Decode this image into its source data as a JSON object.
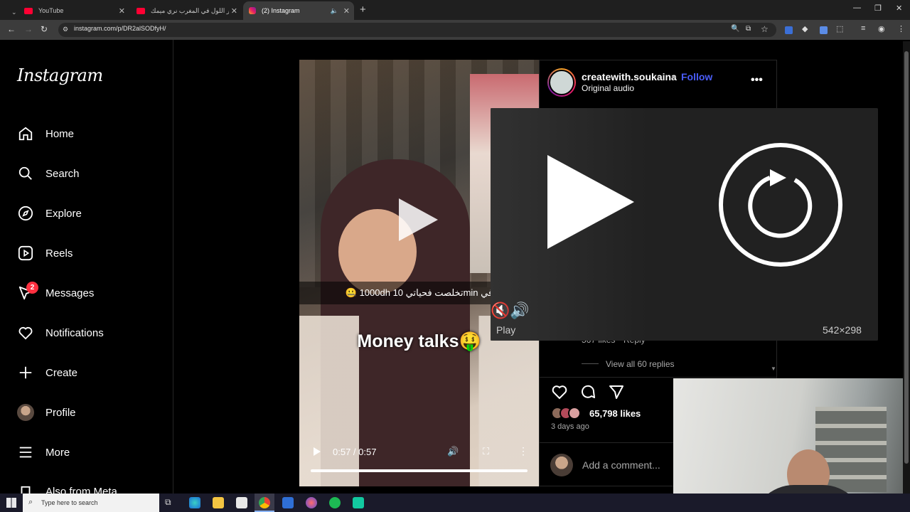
{
  "browser": {
    "tabs": [
      {
        "title": "YouTube"
      },
      {
        "title": "نهار اللول في المغرب نري ميمك..."
      },
      {
        "title": "(2) Instagram"
      }
    ],
    "new_tab": "+",
    "url": "instagram.com/p/DR2alSODfyH/"
  },
  "sidebar": {
    "logo": "Instagram",
    "items": [
      {
        "label": "Home"
      },
      {
        "label": "Search"
      },
      {
        "label": "Explore"
      },
      {
        "label": "Reels"
      },
      {
        "label": "Messages"
      },
      {
        "label": "Notifications"
      },
      {
        "label": "Create"
      },
      {
        "label": "Profile"
      },
      {
        "label": "More"
      },
      {
        "label": "Also from Meta"
      }
    ],
    "messages_badge": "2"
  },
  "video": {
    "caption_ar": "🤐 1000dh تخلصت فحياتي 10min في",
    "overlay_text": "Money talks🤑",
    "time": "0:57 / 0:57",
    "progress": 1.0
  },
  "post": {
    "username": "createwith.soukaina",
    "separator": "•",
    "follow_label": "Follow",
    "audio": "Original audio",
    "comment_likes": "567 likes",
    "reply_label": "Reply",
    "view_replies": "View all 60 replies",
    "likes": "65,798 likes",
    "date": "3 days ago",
    "comment_placeholder": "Add a comment..."
  },
  "overlay": {
    "play_label": "Play",
    "size": "542×298"
  },
  "taskbar": {
    "search_placeholder": "Type here to search"
  },
  "colors": {
    "follow": "#4a5df9",
    "badge": "#ff3040",
    "youtube": "#ff0033"
  }
}
